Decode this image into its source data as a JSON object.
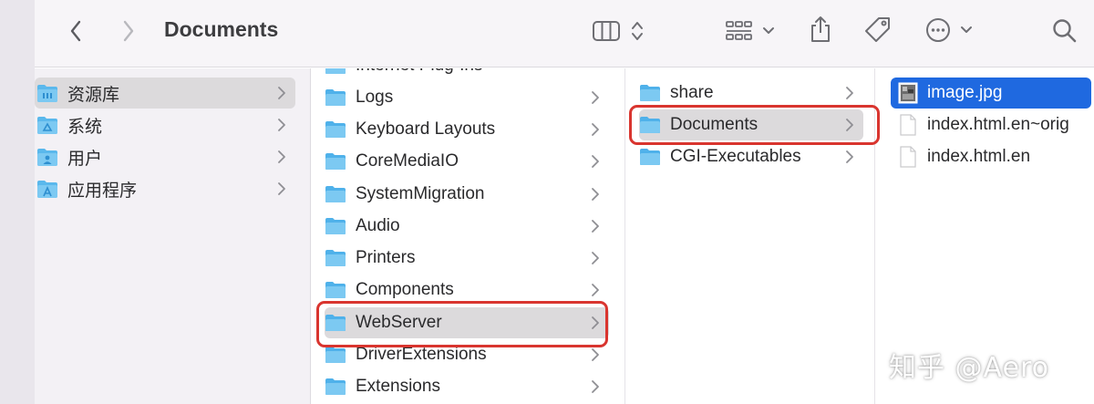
{
  "toolbar": {
    "title": "Documents",
    "icons": [
      "back-icon",
      "forward-icon",
      "column-view-icon",
      "view-toggle-icon",
      "group-icon",
      "share-icon",
      "tag-icon",
      "more-icon",
      "search-icon"
    ]
  },
  "sidebar": {
    "items": [
      {
        "label": "资源库",
        "icon": "library-folder-icon",
        "selected": true
      },
      {
        "label": "系统",
        "icon": "system-folder-icon",
        "selected": false
      },
      {
        "label": "用户",
        "icon": "users-folder-icon",
        "selected": false
      },
      {
        "label": "应用程序",
        "icon": "applications-folder-icon",
        "selected": false
      }
    ]
  },
  "column2": {
    "items": [
      {
        "label": "Internet Plug-Ins"
      },
      {
        "label": "Logs"
      },
      {
        "label": "Keyboard Layouts"
      },
      {
        "label": "CoreMediaIO"
      },
      {
        "label": "SystemMigration"
      },
      {
        "label": "Audio"
      },
      {
        "label": "Printers"
      },
      {
        "label": "Components"
      },
      {
        "label": "WebServer",
        "selected": true
      },
      {
        "label": "DriverExtensions"
      },
      {
        "label": "Extensions"
      }
    ]
  },
  "column3": {
    "items": [
      {
        "label": "share"
      },
      {
        "label": "Documents",
        "selected": true
      },
      {
        "label": "CGI-Executables"
      }
    ]
  },
  "column4": {
    "items": [
      {
        "label": "image.jpg",
        "selected": true
      },
      {
        "label": "index.html.en~orig"
      },
      {
        "label": "index.html.en"
      }
    ]
  },
  "watermark": "知乎 @Aero",
  "colors": {
    "folder_blue": "#5ab8ec",
    "selection_blue": "#1f69e0",
    "highlight_red": "#d9352f"
  }
}
